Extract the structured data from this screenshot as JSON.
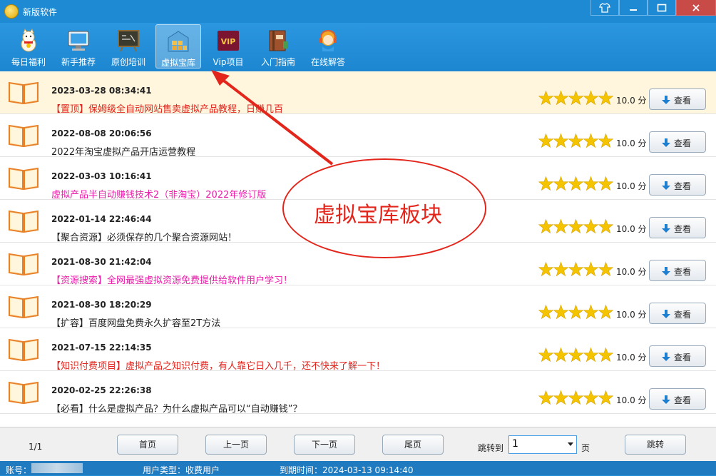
{
  "window": {
    "title": "新版软件",
    "buttons": [
      "shirt-icon",
      "minimize-icon",
      "maximize-icon",
      "close-icon"
    ]
  },
  "toolbar": {
    "items": [
      {
        "label": "每日福利",
        "icon": "lucky-cat-icon"
      },
      {
        "label": "新手推荐",
        "icon": "monitor-icon"
      },
      {
        "label": "原创培训",
        "icon": "chalkboard-icon"
      },
      {
        "label": "虚拟宝库",
        "icon": "warehouse-icon",
        "active": true
      },
      {
        "label": "Vip项目",
        "icon": "vip-icon"
      },
      {
        "label": "入门指南",
        "icon": "guide-book-icon"
      },
      {
        "label": "在线解答",
        "icon": "support-agent-icon"
      }
    ]
  },
  "list": {
    "rows": [
      {
        "date": "2023-03-28 08:34:41",
        "title": "【置顶】保姆级全自动网站售卖虚拟产品教程，日赚几百",
        "color": "#e0241d",
        "highlight": true,
        "stars": 5,
        "score": "10.0 分",
        "button": "查看"
      },
      {
        "date": "2022-08-08 20:06:56",
        "title": "2022年淘宝虚拟产品开店运营教程",
        "color": "#222222",
        "stars": 5,
        "score": "10.0 分",
        "button": "查看"
      },
      {
        "date": "2022-03-03 10:16:41",
        "title": "虚拟产品半自动赚钱技术2（非淘宝）2022年修订版",
        "color": "#e91ea8",
        "stars": 5,
        "score": "10.0 分",
        "button": "查看"
      },
      {
        "date": "2022-01-14 22:46:44",
        "title": "【聚合资源】必须保存的几个聚合资源网站！",
        "color": "#222222",
        "stars": 5,
        "score": "10.0 分",
        "button": "查看"
      },
      {
        "date": "2021-08-30 21:42:04",
        "title": "【资源搜索】全网最强虚拟资源免费提供给软件用户学习！",
        "color": "#e91ea8",
        "stars": 5,
        "score": "10.0 分",
        "button": "查看"
      },
      {
        "date": "2021-08-30 18:20:29",
        "title": "【扩容】百度网盘免费永久扩容至2T方法",
        "color": "#222222",
        "stars": 5,
        "score": "10.0 分",
        "button": "查看"
      },
      {
        "date": "2021-07-15 22:14:35",
        "title": "【知识付费项目】虚拟产品之知识付费，有人靠它日入几千，还不快来了解一下！",
        "color": "#e0241d",
        "stars": 5,
        "score": "10.0 分",
        "button": "查看"
      },
      {
        "date": "2020-02-25 22:26:38",
        "title": "【必看】什么是虚拟产品？为什么虚拟产品可以“自动赚钱”？",
        "color": "#222222",
        "stars": 5,
        "score": "10.0 分",
        "button": "查看"
      }
    ]
  },
  "annotation": {
    "text": "虚拟宝库板块",
    "color": "#e3261c"
  },
  "pager": {
    "page_info": "1/1",
    "first": "首页",
    "prev": "上一页",
    "next": "下一页",
    "last": "尾页",
    "jump_label": "跳转到",
    "jump_value": "1",
    "page_suffix": "页",
    "jump_button": "跳转"
  },
  "status": {
    "account_label": "账号：",
    "user_type": "用户类型：收费用户",
    "expire": "到期时间：2024-03-13 09:14:40"
  }
}
